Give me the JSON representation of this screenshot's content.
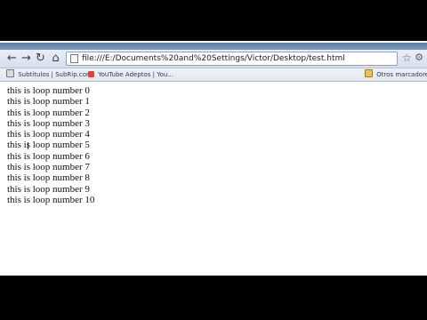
{
  "browser": {
    "address": "file:///E:/Documents%20and%20Settings/Victor/Desktop/test.html",
    "bookmarks": [
      {
        "label": "Subtítulos | SubRip.com",
        "icon": "page-icon"
      },
      {
        "label": "YouTube Adeptos | You...",
        "icon": "youtube-icon"
      },
      {
        "label": "Otros marcadores",
        "icon": "folder-icon"
      }
    ],
    "icons": {
      "back": "back-arrow-icon",
      "forward": "forward-arrow-icon",
      "reload": "reload-icon",
      "home": "home-icon",
      "star": "star-icon",
      "wrench": "wrench-icon"
    }
  },
  "page": {
    "lines": [
      "this is loop number 0",
      "this is loop number 1",
      "this is loop number 2",
      "this is loop number 3",
      "this is loop number 4",
      "this is loop number 5",
      "this is loop number 6",
      "this is loop number 7",
      "this is loop number 8",
      "this is loop number 9",
      "this is loop number 10"
    ]
  }
}
